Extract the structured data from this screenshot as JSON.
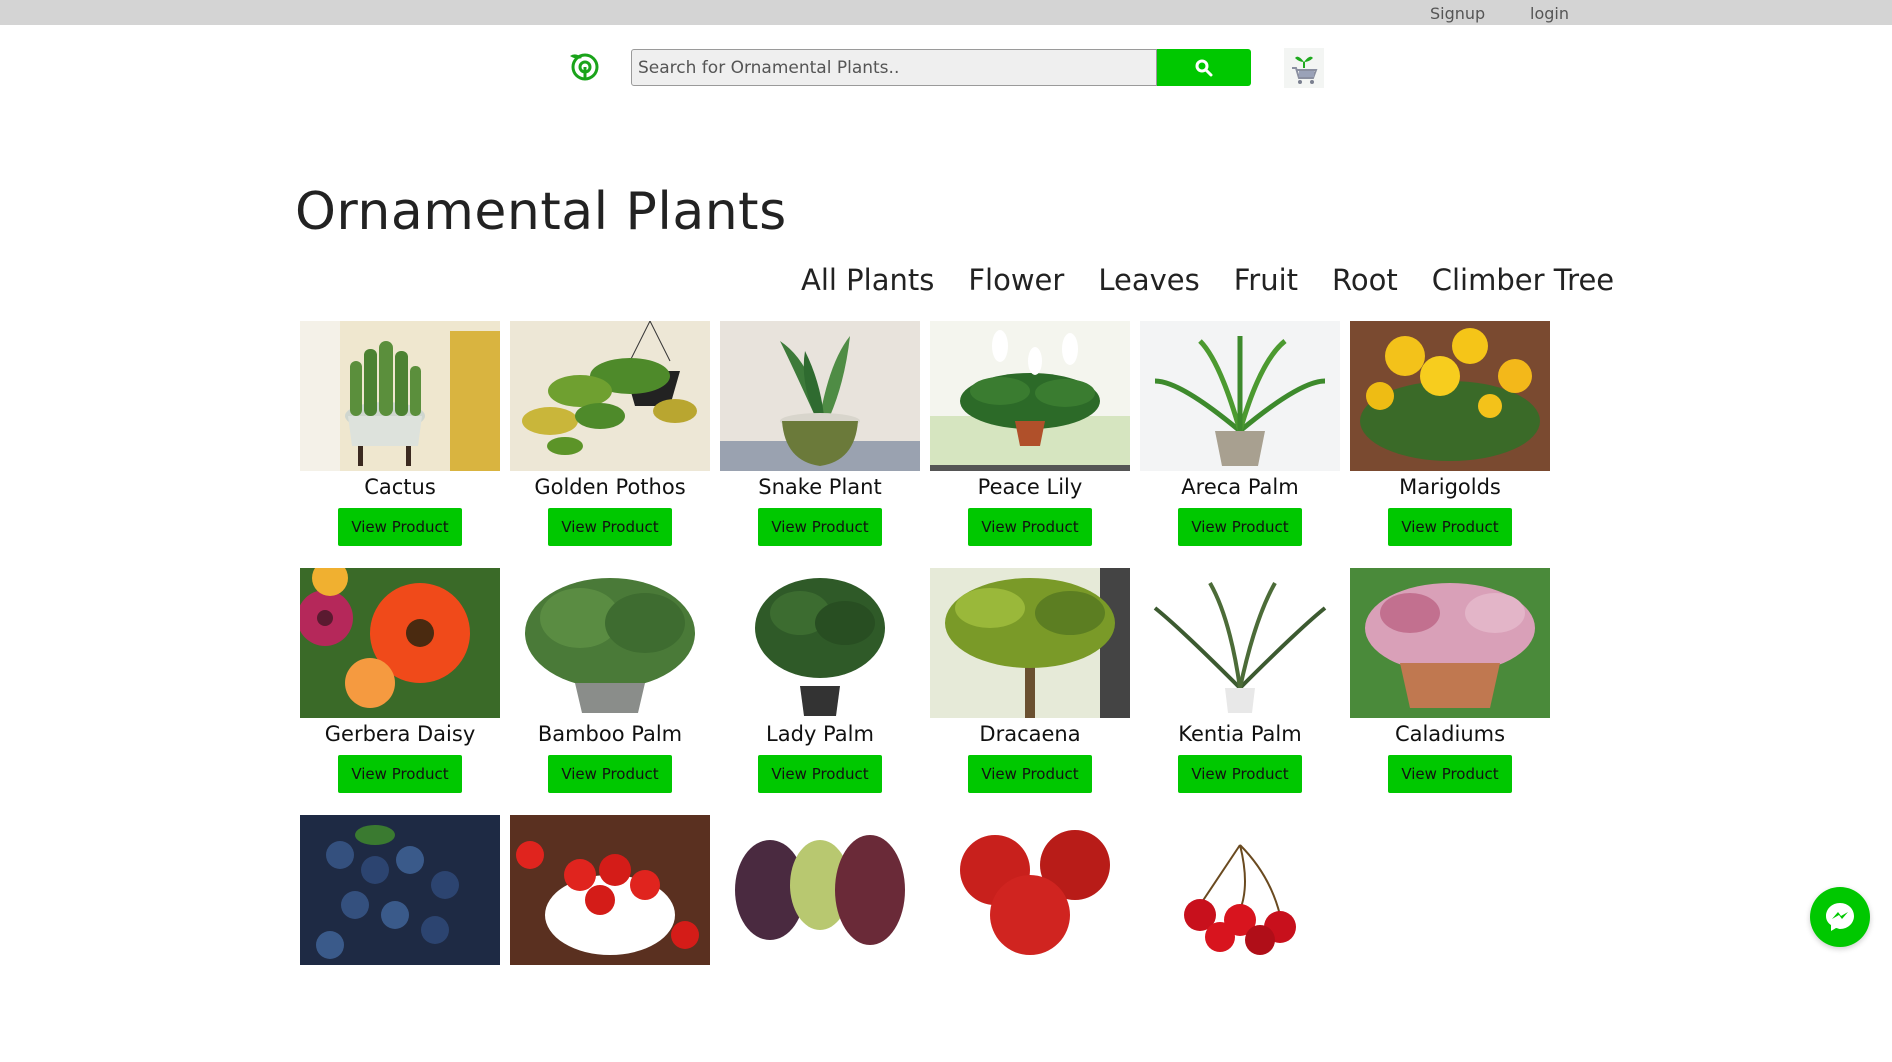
{
  "topbar": {
    "signup": "Signup",
    "login": "login"
  },
  "search": {
    "placeholder": "Search for Ornamental Plants.."
  },
  "page_title": "Ornamental Plants",
  "categories": [
    "All Plants",
    "Flower",
    "Leaves",
    "Fruit",
    "Root",
    "Climber Tree"
  ],
  "button_label": "View Product",
  "products_row1": [
    "Cactus",
    "Golden Pothos",
    "Snake Plant",
    "Peace Lily",
    "Areca Palm",
    "Marigolds"
  ],
  "products_row2": [
    "Gerbera Daisy",
    "Bamboo Palm",
    "Lady Palm",
    "Dracaena",
    "Kentia Palm",
    "Caladiums"
  ],
  "colors": {
    "accent": "#00c800",
    "topbar": "#d4d4d4"
  }
}
